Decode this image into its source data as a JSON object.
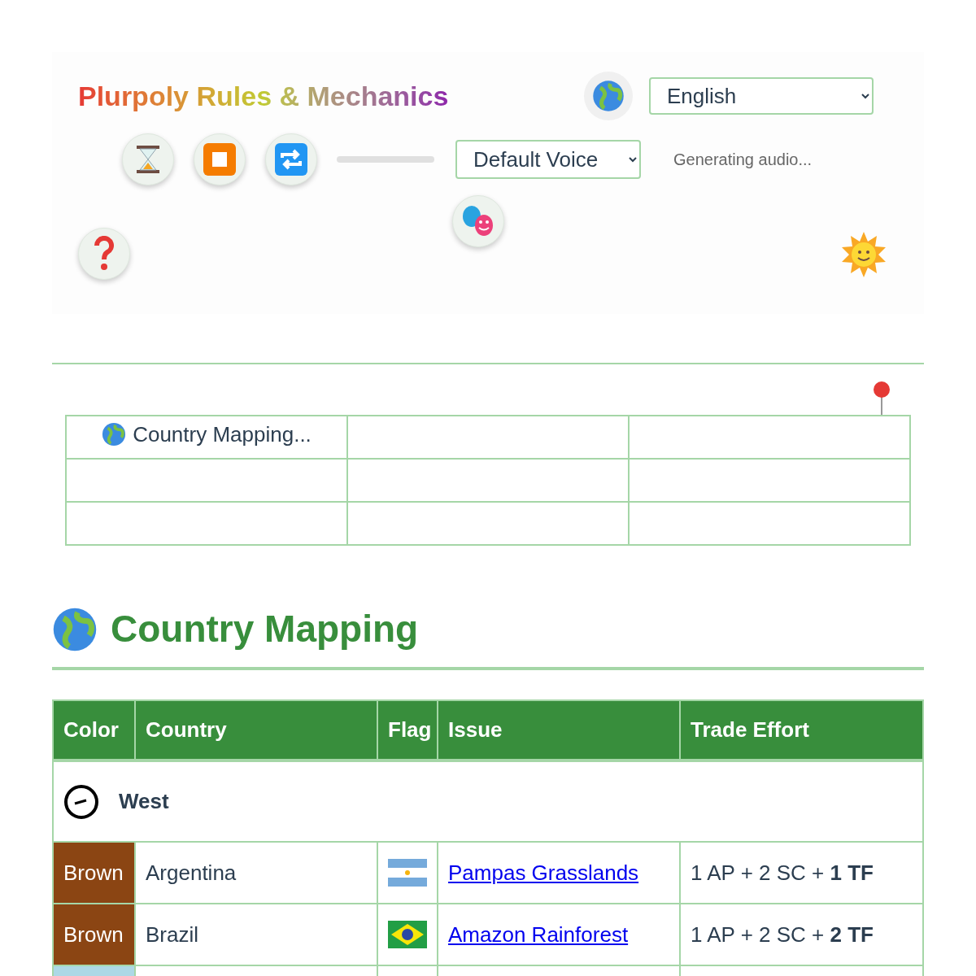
{
  "header": {
    "title": "Plurpoly Rules & Mechanics",
    "language": "English",
    "voice": "Default Voice",
    "status": "Generating audio..."
  },
  "toc": {
    "rows": [
      [
        "Country Mapping...",
        "",
        ""
      ],
      [
        "",
        "",
        ""
      ],
      [
        "",
        "",
        ""
      ]
    ]
  },
  "section": {
    "title": "Country Mapping"
  },
  "table": {
    "columns": [
      "Color",
      "Country",
      "Flag",
      "Issue",
      "Trade Effort"
    ],
    "group": "West",
    "rows": [
      {
        "color_name": "Brown",
        "color": "#8b4513",
        "country": "Argentina",
        "kind": "argentina",
        "issue": "Pampas Grasslands",
        "effort": "1 AP + 2 SC + **1 TF**"
      },
      {
        "color_name": "Brown",
        "color": "#8b4513",
        "country": "Brazil",
        "kind": "brazil",
        "issue": "Amazon Rainforest",
        "effort": "1 AP + 2 SC + **2 TF**"
      },
      {
        "color": "#add8e6"
      }
    ]
  }
}
